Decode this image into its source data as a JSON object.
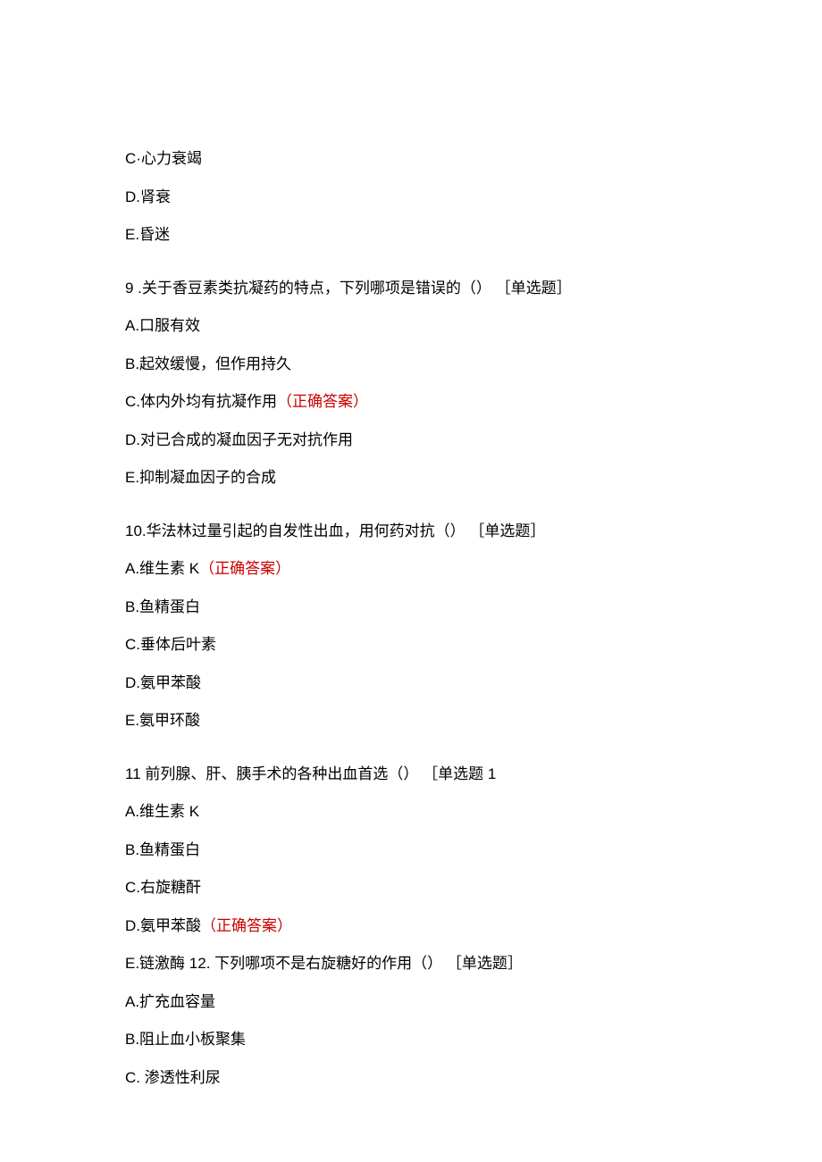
{
  "q8_partial": {
    "options": [
      "C·心力衰竭",
      "D.肾衰",
      "E.昏迷"
    ]
  },
  "q9": {
    "stem": "9   .关于香豆素类抗凝药的特点，下列哪项是错误的（） ［单选题］",
    "options": {
      "a": "A.口服有效",
      "b": "B.起效缓慢，但作用持久",
      "c_prefix": "C.体内外均有抗凝作用",
      "c_answer": "（正确答案）",
      "d": "D.对已合成的凝血因子无对抗作用",
      "e": "E.抑制凝血因子的合成"
    }
  },
  "q10": {
    "stem": "10.华法林过量引起的自发性出血，用何药对抗（） ［单选题］",
    "options": {
      "a_prefix": "A.维生素 K",
      "a_answer": "（正确答案）",
      "b": "B.鱼精蛋白",
      "c": "C.垂体后叶素",
      "d": "D.氨甲苯酸",
      "e": "E.氨甲环酸"
    }
  },
  "q11": {
    "stem": "11 前列腺、肝、胰手术的各种出血首选（） ［单选题 1",
    "options": {
      "a": "A.维生素 K",
      "b": "B.鱼精蛋白",
      "c": "C.右旋糖酐",
      "d_prefix": "D.氨甲苯酸",
      "d_answer": "（正确答案）",
      "e_and_q12": "E.链激酶 12. 下列哪项不是右旋糖好的作用（） ［单选题］"
    }
  },
  "q12": {
    "options": {
      "a": "A.扩充血容量",
      "b": "B.阻止血小板聚集",
      "c": "C. 渗透性利尿"
    }
  }
}
